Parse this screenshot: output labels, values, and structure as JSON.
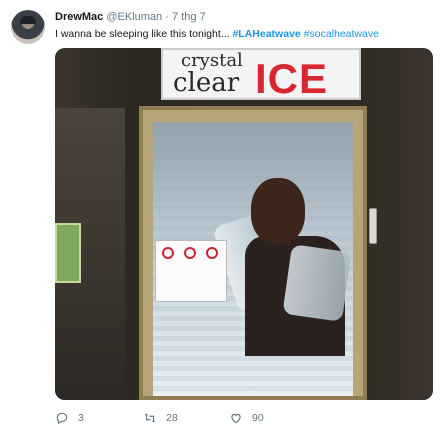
{
  "tweet": {
    "author_name": "DrewMac",
    "author_handle": "@EKluman",
    "separator": "·",
    "timestamp": "7 thg 7",
    "text_prefix": "I wanna be sleeping like this tonight... ",
    "hashtag1": "#LAHeatwave",
    "hashtag2": "#socalheatwave"
  },
  "photo": {
    "sign_line1": "crystal",
    "sign_line2": "clear",
    "sign_brand": "ICE"
  },
  "actions": {
    "reply_count": "3",
    "retweet_count": "28",
    "like_count": "90"
  },
  "colors": {
    "link": "#1b95e0",
    "muted": "#657786",
    "ice_red": "#d7282f"
  }
}
